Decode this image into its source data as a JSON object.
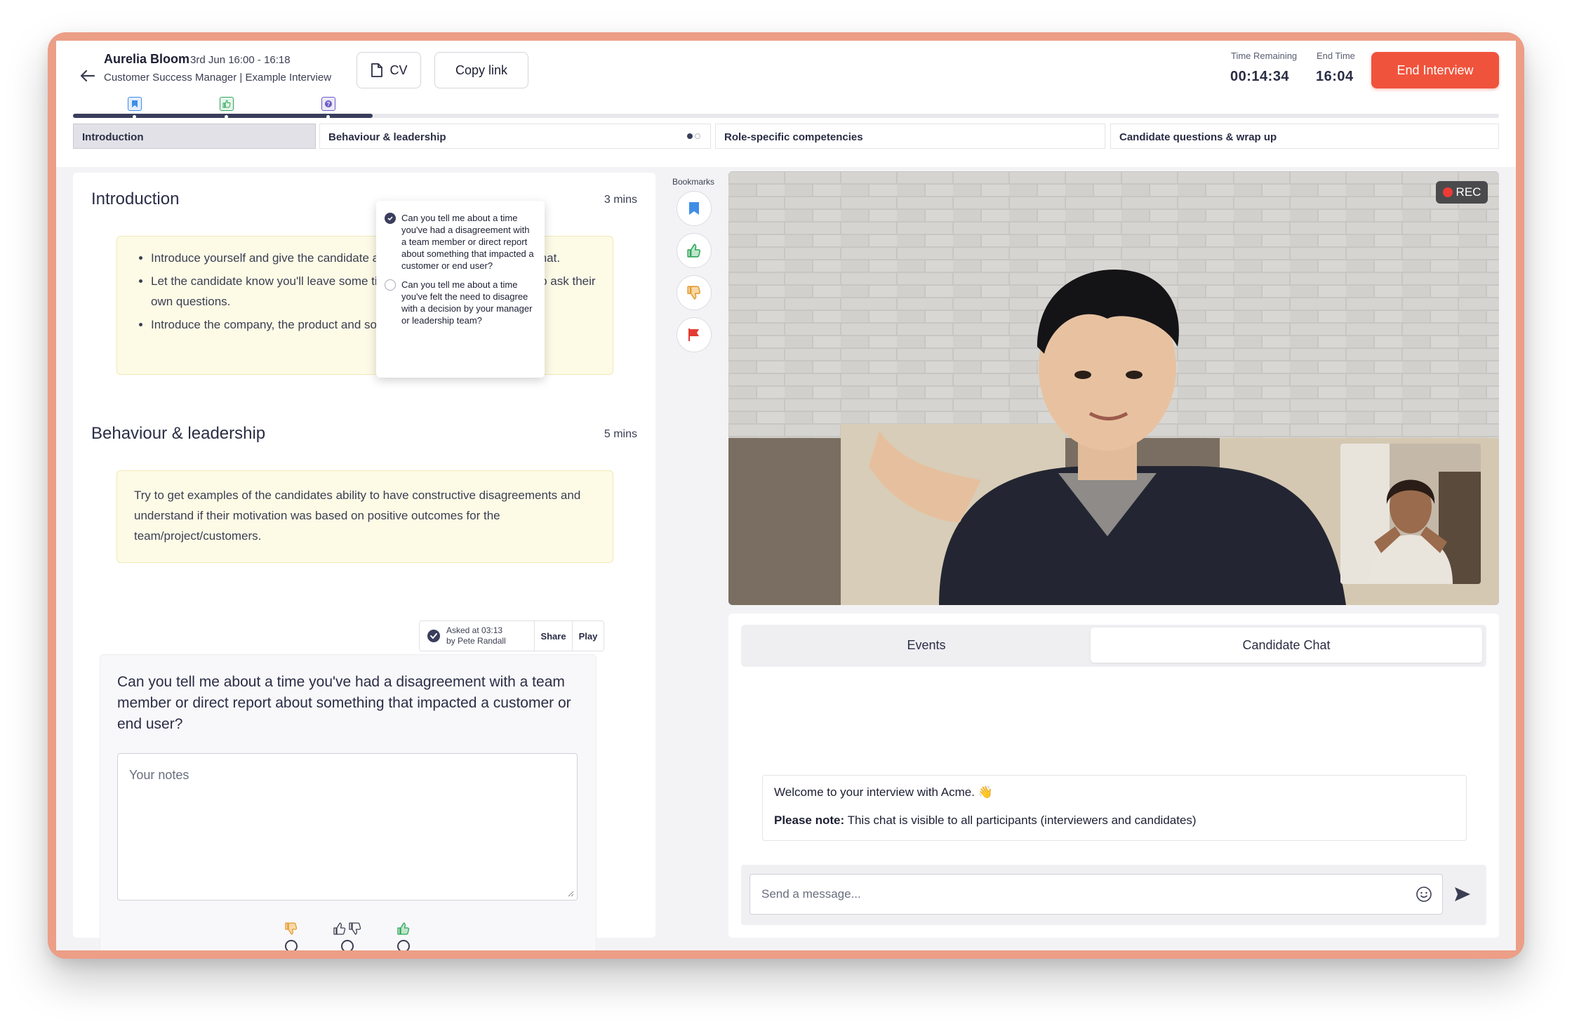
{
  "header": {
    "candidate_name": "Aurelia Bloom",
    "schedule": "3rd Jun 16:00 - 16:18",
    "role_line": "Customer Success Manager | Example Interview",
    "cv_label": "CV",
    "copy_link_label": "Copy link",
    "time_remaining_label": "Time Remaining",
    "time_remaining_value": "00:14:34",
    "end_time_label": "End Time",
    "end_time_value": "16:04",
    "end_button_label": "End Interview"
  },
  "progress": {
    "fraction": 0.21
  },
  "sections": [
    {
      "label": "Introduction",
      "active": true
    },
    {
      "label": "Behaviour & leadership",
      "active": false
    },
    {
      "label": "Role-specific competencies",
      "active": false
    },
    {
      "label": "Candidate questions & wrap up",
      "active": false
    }
  ],
  "left": {
    "intro": {
      "title": "Introduction",
      "duration": "3 mins",
      "bullets": [
        "Introduce yourself and give the candidate an overview of the interview format.",
        "Let the candidate know you'll leave some time at the end of the interview to ask their own questions.",
        "Introduce the company, the product and some details about the role."
      ]
    },
    "behaviour": {
      "title": "Behaviour & leadership",
      "duration": "5 mins",
      "guidance": "Try to get examples of the candidates ability to have constructive disagreements and understand if their motivation was based on positive outcomes for the team/project/customers."
    },
    "question": {
      "asked_line1": "Asked at 03:13",
      "asked_line2": "by Pete Randall",
      "share_label": "Share",
      "play_label": "Play",
      "text": "Can you tell me about a time you've had a disagreement with a team member or direct report about something that impacted a customer or end user?",
      "notes_placeholder": "Your notes"
    },
    "popover": [
      {
        "text": "Can you tell me about a time you've had a disagreement with a team member or direct report about something that impacted a customer or end user?",
        "checked": true
      },
      {
        "text": "Can you tell me about a time you've felt the need to disagree with a decision by your manager or leadership team?",
        "checked": false
      }
    ]
  },
  "bookmarks": {
    "label": "Bookmarks",
    "icons": [
      "bookmark-icon",
      "thumbs-up-icon",
      "thumbs-down-icon",
      "flag-icon"
    ]
  },
  "video": {
    "rec_label": "REC"
  },
  "chat": {
    "tabs": [
      "Events",
      "Candidate Chat"
    ],
    "active_tab": "Candidate Chat",
    "welcome": "Welcome to your interview with Acme. 👋",
    "note_bold": "Please note:",
    "note_text": " This chat is visible to all participants (interviewers and candidates)",
    "input_placeholder": "Send a message..."
  },
  "colors": {
    "accent": "#f0533c",
    "primary": "#3a3e5c",
    "frame": "#ec9e86",
    "note_bg": "#fdfbe6",
    "bookmark": "#3f8ee6",
    "positive": "#2fa55a",
    "negative": "#e59a2f",
    "flag": "#e33b33"
  }
}
